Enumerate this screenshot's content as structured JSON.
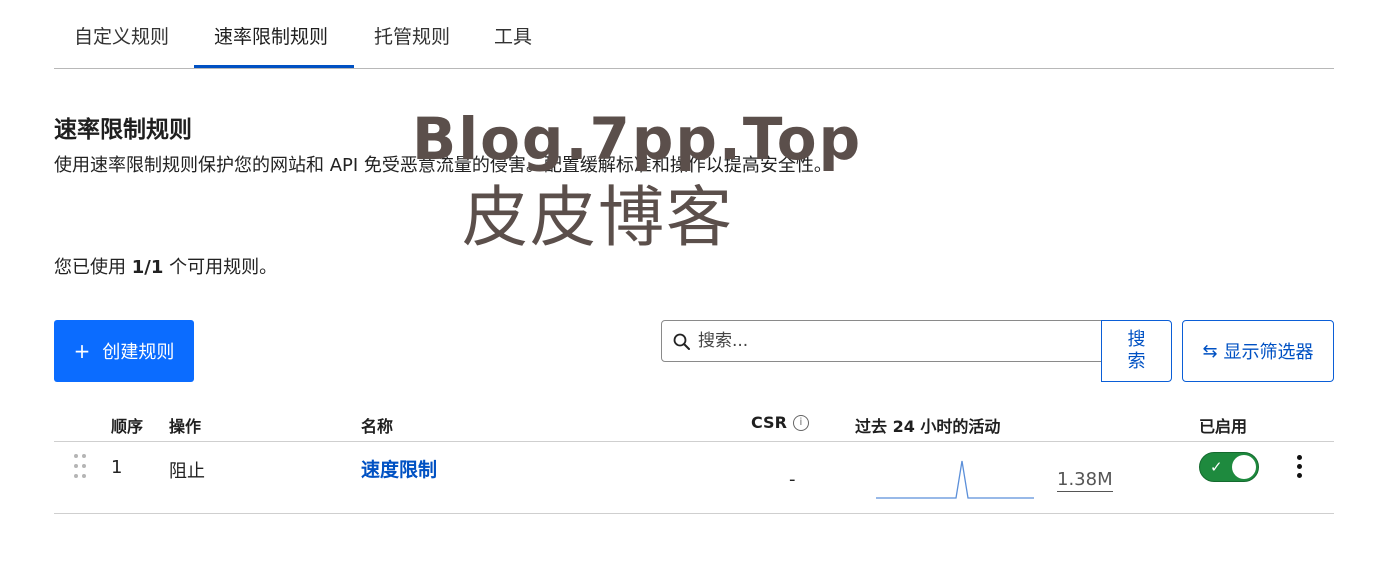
{
  "tabs": [
    {
      "label": "自定义规则"
    },
    {
      "label": "速率限制规则",
      "active": true
    },
    {
      "label": "托管规则"
    },
    {
      "label": "工具"
    }
  ],
  "section": {
    "title": "速率限制规则",
    "description": "使用速率限制规则保护您的网站和 API 免受恶意流量的侵害。配置缓解标准和操作以提高安全性。",
    "usage_prefix": "您已使用 ",
    "usage_count": "1/1",
    "usage_suffix": " 个可用规则。"
  },
  "watermark": {
    "line1": "Blog.7pp.Top",
    "line2": "皮皮博客"
  },
  "toolbar": {
    "create_label": "创建规则",
    "search_placeholder": "搜索...",
    "search_button_label": "搜索",
    "filter_label": "显示筛选器"
  },
  "table": {
    "headers": {
      "order": "顺序",
      "action": "操作",
      "name": "名称",
      "csr": "CSR",
      "activity": "过去 24 小时的活动",
      "enabled": "已启用"
    },
    "rows": [
      {
        "order": "1",
        "action": "阻止",
        "name": "速度限制",
        "csr": "-",
        "activity_count": "1.38M",
        "enabled": true
      }
    ]
  },
  "colors": {
    "accent": "#0051c3",
    "primary_button": "#0b6cff",
    "toggle_on": "#1e8a3e",
    "sparkline": "#5b8fd9"
  },
  "icons": {
    "search": "search-icon",
    "filter": "swap-arrows-icon",
    "info": "info-icon",
    "drag": "drag-handle-icon",
    "more": "kebab-menu-icon",
    "check": "check-icon"
  }
}
